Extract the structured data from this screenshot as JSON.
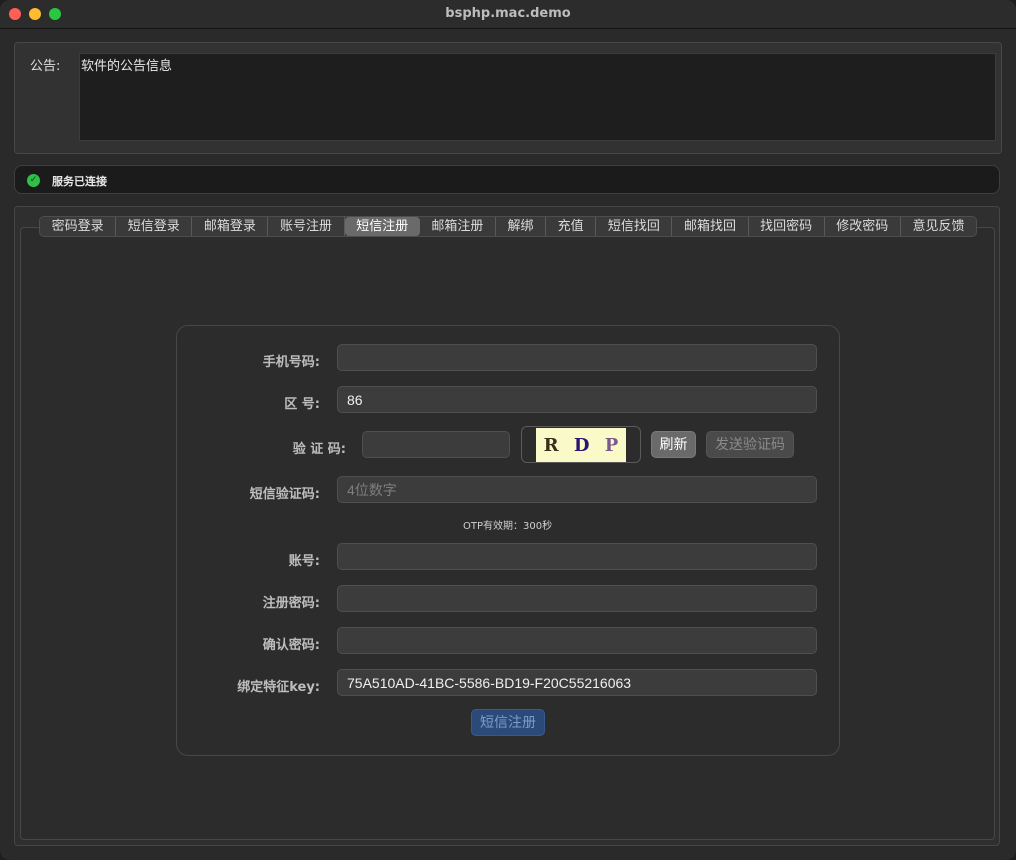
{
  "window": {
    "title": "bsphp.mac.demo"
  },
  "notice": {
    "label": "公告:",
    "text": "软件的公告信息"
  },
  "status": {
    "text": "服务已连接",
    "icon": "check-circle-icon",
    "color": "#30c04a"
  },
  "tabs": [
    {
      "label": "密码登录"
    },
    {
      "label": "短信登录"
    },
    {
      "label": "邮箱登录"
    },
    {
      "label": "账号注册"
    },
    {
      "label": "短信注册"
    },
    {
      "label": "邮箱注册"
    },
    {
      "label": "解绑"
    },
    {
      "label": "充值"
    },
    {
      "label": "短信找回"
    },
    {
      "label": "邮箱找回"
    },
    {
      "label": "找回密码"
    },
    {
      "label": "修改密码"
    },
    {
      "label": "意见反馈"
    }
  ],
  "active_tab": "短信注册",
  "form": {
    "phone": {
      "label": "手机号码:",
      "value": ""
    },
    "area_code": {
      "label": "区 号:",
      "value": "86"
    },
    "captcha": {
      "label": "验 证 码:",
      "value": "",
      "image_chars": [
        "R",
        "D",
        "P"
      ]
    },
    "refresh_label": "刷新",
    "send_code_label": "发送验证码",
    "sms_code": {
      "label": "短信验证码:",
      "value": "",
      "placeholder": "4位数字"
    },
    "otp_hint": "OTP有效期：300秒",
    "account": {
      "label": "账号:",
      "value": ""
    },
    "password": {
      "label": "注册密码:",
      "value": ""
    },
    "confirm_password": {
      "label": "确认密码:",
      "value": ""
    },
    "bind_key": {
      "label": "绑定特征key:",
      "value": "75A510AD-41BC-5586-BD19-F20C55216063"
    },
    "submit_label": "短信注册"
  }
}
